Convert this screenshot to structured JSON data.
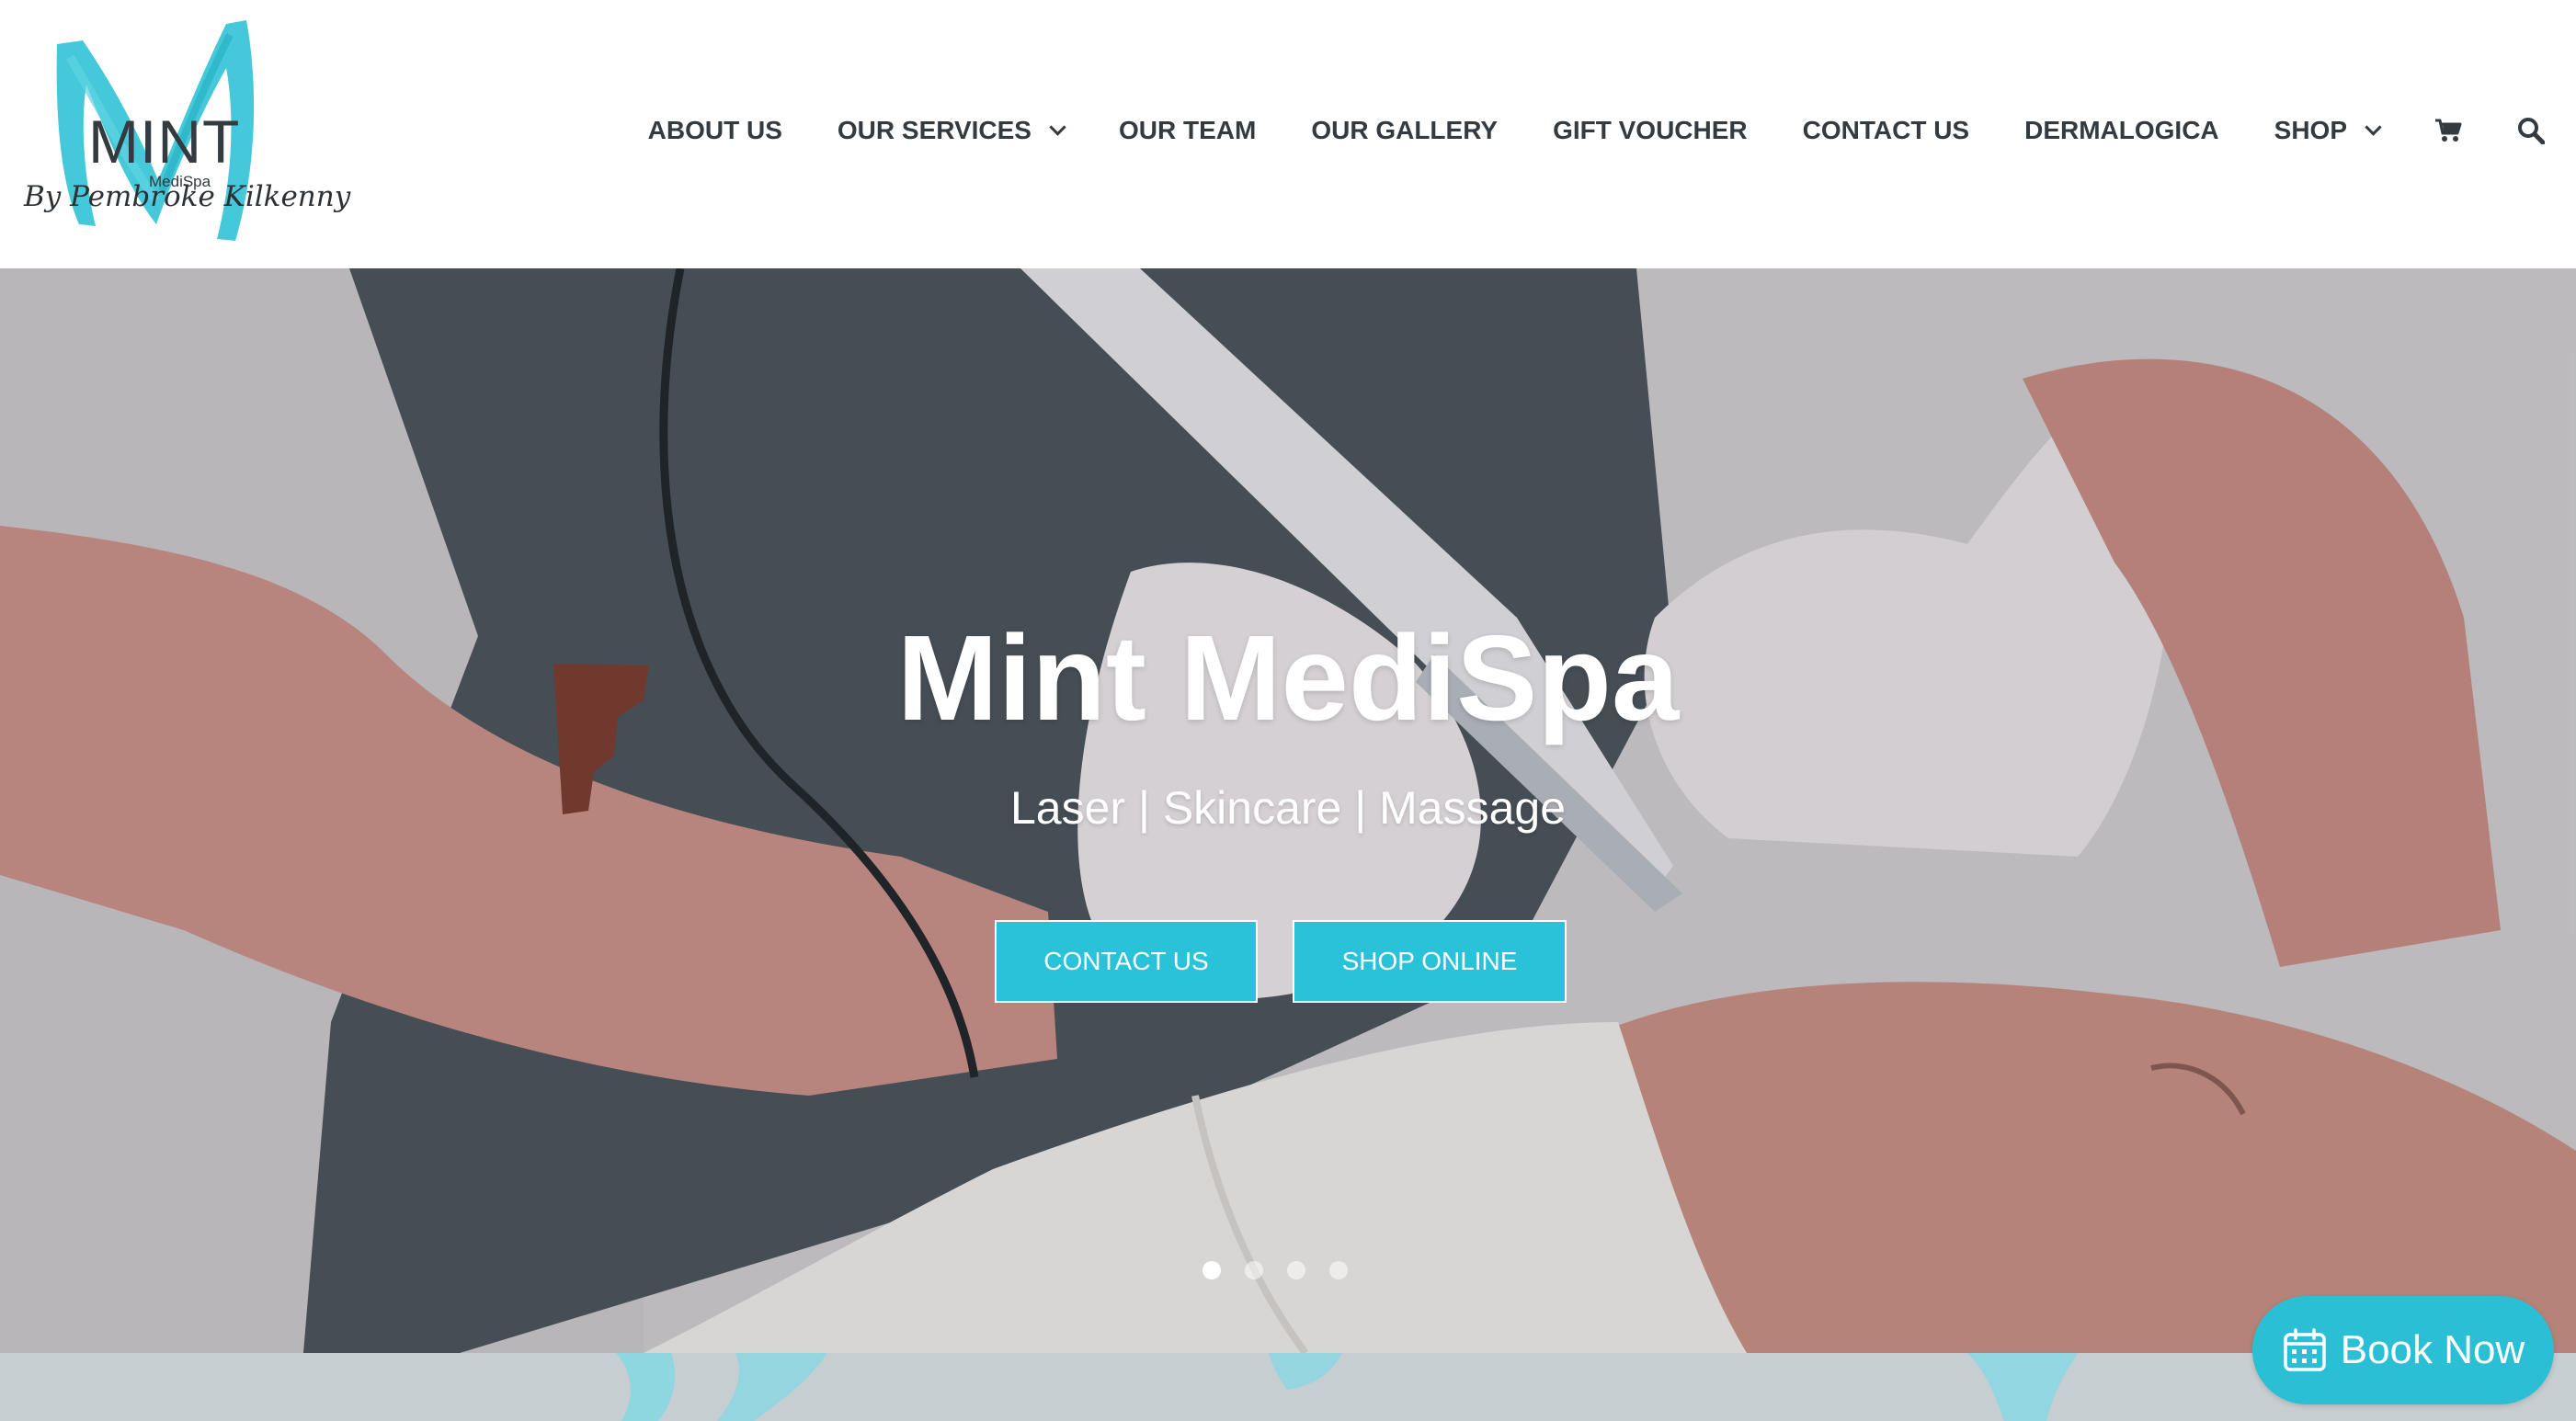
{
  "brand": {
    "logo_word": "MINT",
    "logo_sub": "MediSpa",
    "logo_script": "By Pembroke Kilkenny",
    "accent_color": "#29c2d9"
  },
  "nav": {
    "items": [
      {
        "label": "ABOUT US"
      },
      {
        "label": "OUR SERVICES"
      },
      {
        "label": "OUR TEAM"
      },
      {
        "label": "OUR GALLERY"
      },
      {
        "label": "GIFT VOUCHER"
      },
      {
        "label": "CONTACT US"
      },
      {
        "label": "DERMALOGICA"
      },
      {
        "label": "SHOP"
      }
    ],
    "icons": [
      "shopping-cart-icon",
      "search-icon"
    ]
  },
  "hero": {
    "title": "Mint MediSpa",
    "subtitle": "Laser | Skincare | Massage",
    "buttons": {
      "contact": "CONTACT US",
      "shop": "SHOP ONLINE"
    },
    "slider": {
      "total": 4,
      "active": 1
    }
  },
  "widget": {
    "book_now": "Book Now"
  }
}
